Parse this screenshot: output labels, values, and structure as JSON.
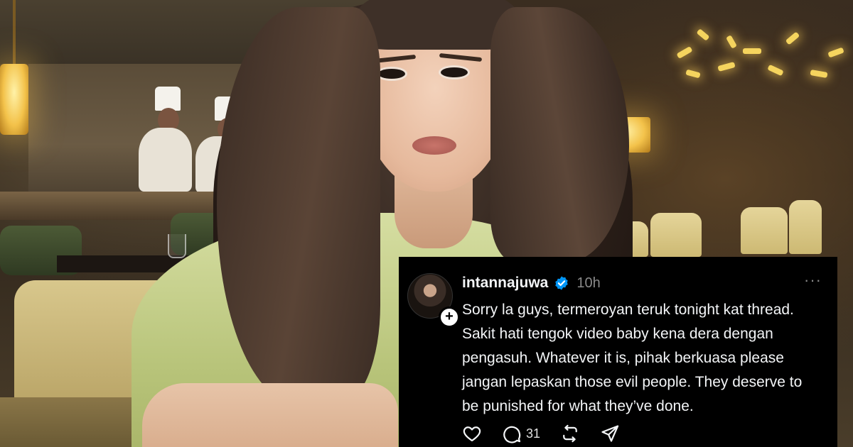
{
  "post": {
    "username": "intannajuwa",
    "time": "10h",
    "more": "···",
    "lines": [
      "Sorry la guys, termeroyan teruk tonight kat thread.",
      "Sakit hati tengok video baby kena dera dengan",
      "pengasuh. Whatever it is, pihak berkuasa please",
      "jangan lepaskan those evil people. They deserve to",
      "be punished for what they’ve done."
    ],
    "reply_count": "31",
    "plus": "+"
  },
  "icons": {
    "verified": "verified-badge-icon",
    "like": "heart-icon",
    "reply": "comment-icon",
    "repost": "repost-icon",
    "share": "send-icon"
  },
  "colors": {
    "card_bg": "#000000",
    "text": "#f3f5f7",
    "muted": "#8a8a8a",
    "verified": "#0095f6"
  }
}
